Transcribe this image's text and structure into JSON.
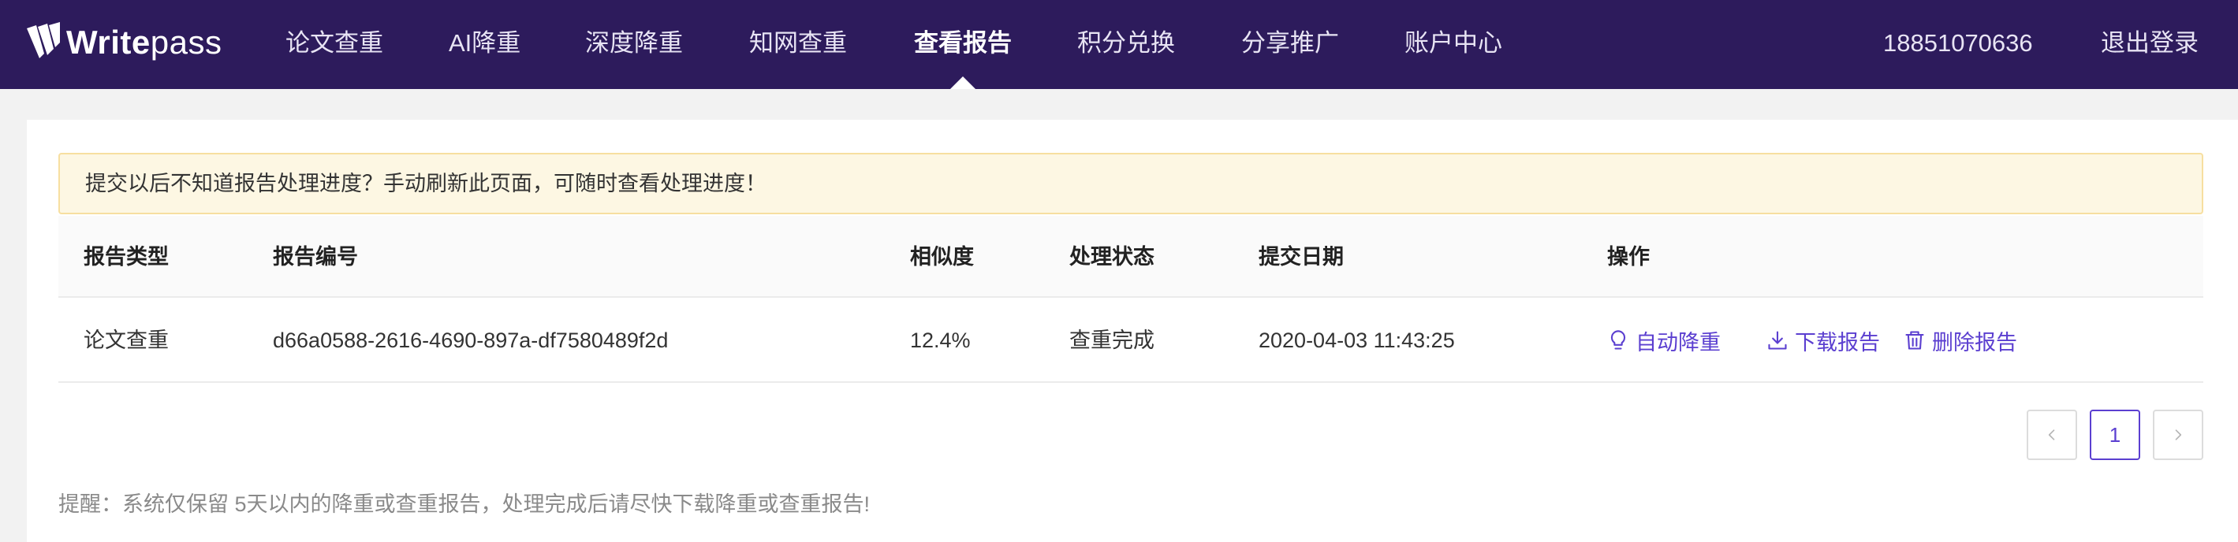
{
  "brand": {
    "logo_bold": "Write",
    "logo_light": "pass"
  },
  "nav": {
    "items": [
      {
        "label": "论文查重"
      },
      {
        "label": "AI降重"
      },
      {
        "label": "深度降重"
      },
      {
        "label": "知网查重"
      },
      {
        "label": "查看报告",
        "active": true
      },
      {
        "label": "积分兑换"
      },
      {
        "label": "分享推广"
      },
      {
        "label": "账户中心"
      }
    ],
    "phone": "18851070636",
    "logout": "退出登录"
  },
  "notice": "提交以后不知道报告处理进度？手动刷新此页面，可随时查看处理进度！",
  "table": {
    "columns": [
      "报告类型",
      "报告编号",
      "相似度",
      "处理状态",
      "提交日期",
      "操作"
    ],
    "rows": [
      {
        "type": "论文查重",
        "id": "d66a0588-2616-4690-897a-df7580489f2d",
        "similarity": "12.4%",
        "status": "查重完成",
        "date": "2020-04-03 11:43:25",
        "actions": [
          "自动降重",
          "下载报告",
          "删除报告"
        ]
      }
    ]
  },
  "pagination": {
    "current": "1"
  },
  "tip": "提醒：系统仅保留 5天以内的降重或查重报告，处理完成后请尽快下载降重或查重报告!",
  "colors": {
    "header_bg": "#2d1b5c",
    "accent": "#5b3fd0",
    "notice_bg": "#fdf7e3",
    "notice_border": "#f7dfa0"
  }
}
